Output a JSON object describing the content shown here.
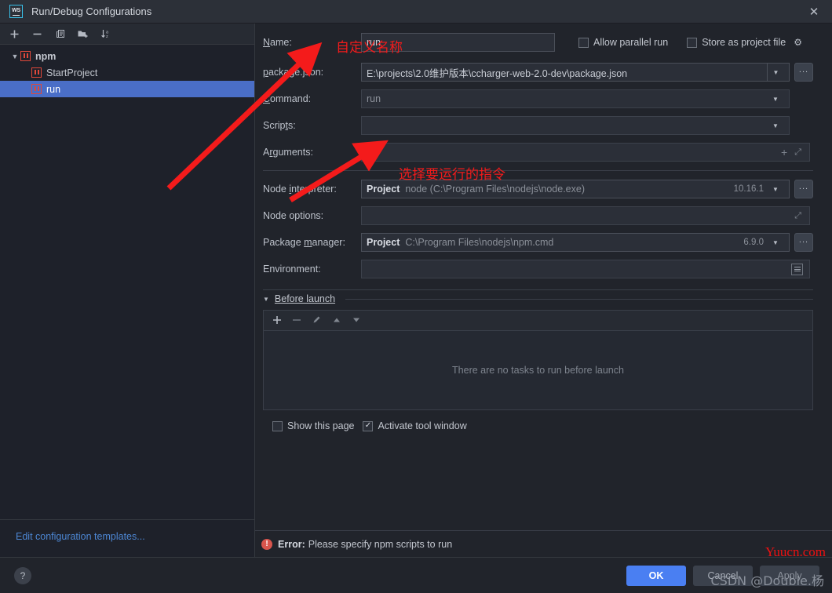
{
  "window": {
    "title": "Run/Debug Configurations",
    "app_icon": "webstorm-icon",
    "close_icon": "✕"
  },
  "left_panel": {
    "toolbar": [
      {
        "name": "add-configuration-button",
        "glyph": "+"
      },
      {
        "name": "remove-configuration-button",
        "glyph": "−"
      },
      {
        "name": "copy-configuration-button",
        "glyph": "❐"
      },
      {
        "name": "save-configuration-button",
        "glyph": "📁"
      },
      {
        "name": "sort-configurations-button",
        "glyph": "↓"
      }
    ],
    "tree": [
      {
        "label": "npm",
        "level": 0,
        "expanded": true,
        "selected": false
      },
      {
        "label": "StartProject",
        "level": 1,
        "expanded": false,
        "selected": false
      },
      {
        "label": "run",
        "level": 1,
        "expanded": false,
        "selected": true
      }
    ],
    "edit_templates_link": "Edit configuration templates..."
  },
  "form": {
    "name_label": "Name:",
    "name_value": "run",
    "allow_parallel_run": {
      "label": "Allow parallel run",
      "checked": false
    },
    "store_as_project_file": {
      "label": "Store as project file",
      "checked": false
    },
    "package_json_label": "package.json:",
    "package_json_value": "E:\\projects\\2.0维护版本\\ccharger-web-2.0-dev\\package.json",
    "command_label": "Command:",
    "command_value": "run",
    "scripts_label": "Scripts:",
    "scripts_value": "",
    "arguments_label": "Arguments:",
    "arguments_value": "",
    "node_interpreter_label": "Node interpreter:",
    "node_interpreter_scope": "Project",
    "node_interpreter_value": "node (C:\\Program Files\\nodejs\\node.exe)",
    "node_interpreter_version": "10.16.1",
    "node_options_label": "Node options:",
    "node_options_value": "",
    "package_manager_label": "Package manager:",
    "package_manager_scope": "Project",
    "package_manager_value": "C:\\Program Files\\nodejs\\npm.cmd",
    "package_manager_version": "6.9.0",
    "environment_label": "Environment:",
    "environment_value": "",
    "browse_button_label": "..."
  },
  "before_launch": {
    "title": "Before launch",
    "toolbar": [
      {
        "name": "add-task-button",
        "glyph": "+"
      },
      {
        "name": "remove-task-button",
        "glyph": "−"
      },
      {
        "name": "edit-task-button",
        "glyph": "✎"
      },
      {
        "name": "move-task-up-button",
        "glyph": "▲"
      },
      {
        "name": "move-task-down-button",
        "glyph": "▼"
      }
    ],
    "empty_text": "There are no tasks to run before launch",
    "show_this_page": {
      "label": "Show this page",
      "checked": false
    },
    "activate_tool_window": {
      "label": "Activate tool window",
      "checked": true
    }
  },
  "status": {
    "error_prefix": "Error:",
    "error_message": "Please specify npm scripts to run"
  },
  "footer": {
    "help_label": "?",
    "ok_label": "OK",
    "cancel_label": "Cancel",
    "apply_label": "Apply"
  },
  "annotations": [
    {
      "name": "annotation-custom-name",
      "text": "自定义名称"
    },
    {
      "name": "annotation-choose-script",
      "text": "选择要运行的指令"
    }
  ],
  "watermarks": {
    "red": "Yuucn.com",
    "grey": "CSDN @Double.杨"
  },
  "colors": {
    "accent": "#4a7ff2",
    "selection": "#4a6ec7",
    "annotation": "#f41b1b",
    "error": "#d9554d",
    "link": "#4d87d4",
    "npm_icon": "#e0483a"
  }
}
